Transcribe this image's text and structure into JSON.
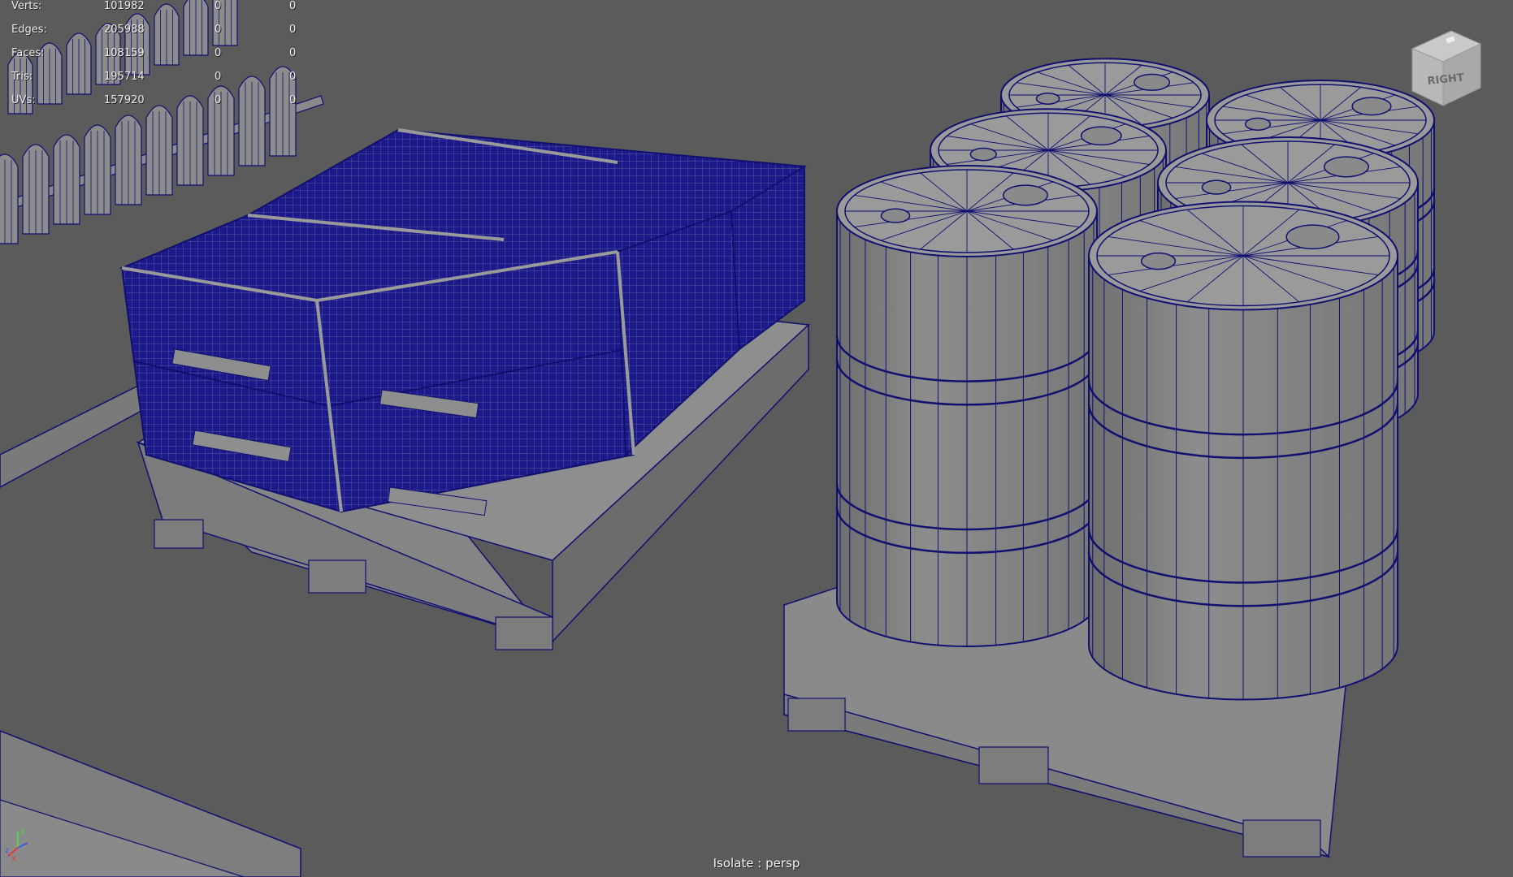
{
  "viewport": {
    "camera_label": "Isolate : persp",
    "viewcube_face": "RIGHT",
    "background_color": "#5b5b5b",
    "wireframe_color": "#101070",
    "surface_color": "#8a8a8a"
  },
  "hud_stats": [
    {
      "label": "Verts:",
      "total": "101982",
      "selected": "0",
      "components": "0"
    },
    {
      "label": "Edges:",
      "total": "205988",
      "selected": "0",
      "components": "0"
    },
    {
      "label": "Faces:",
      "total": "108159",
      "selected": "0",
      "components": "0"
    },
    {
      "label": "Tris:",
      "total": "195714",
      "selected": "0",
      "components": "0"
    },
    {
      "label": "UVs:",
      "total": "157920",
      "selected": "0",
      "components": "0"
    }
  ],
  "axis_gizmo": {
    "x": "x",
    "y": "y",
    "z": "z"
  }
}
